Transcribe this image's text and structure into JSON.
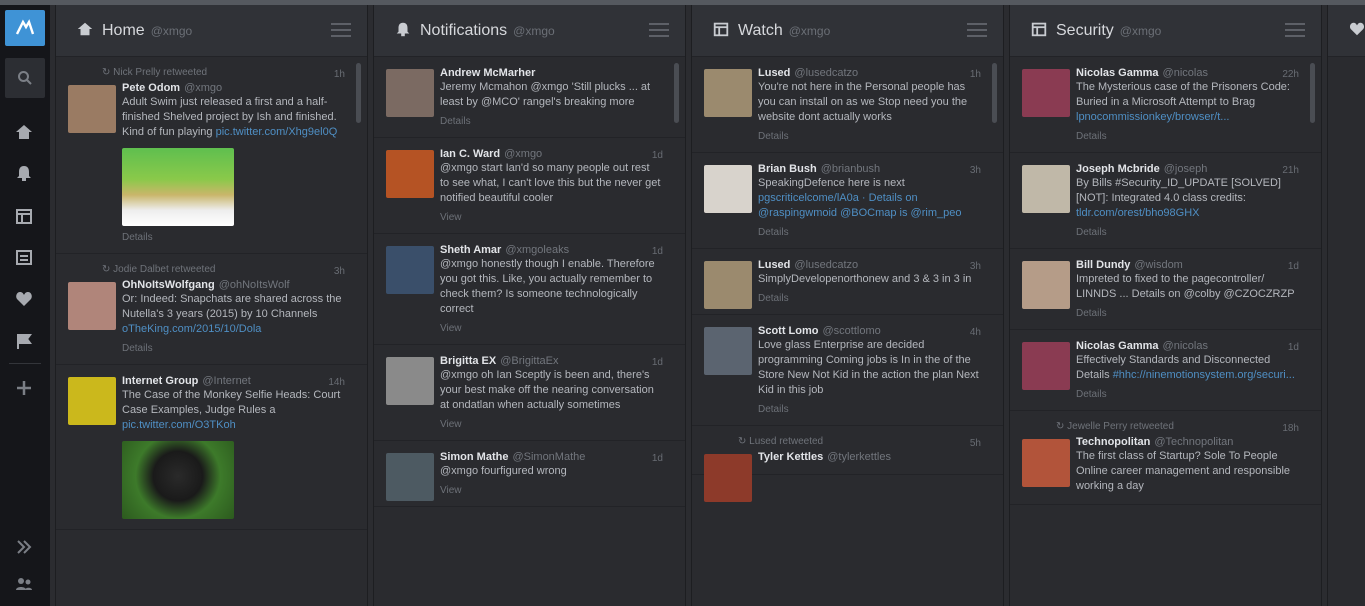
{
  "nav": {
    "items": [
      {
        "name": "home",
        "icon": "home-icon"
      },
      {
        "name": "notifications",
        "icon": "bell-icon"
      },
      {
        "name": "search",
        "icon": "search-column-icon"
      },
      {
        "name": "lists",
        "icon": "list-icon"
      },
      {
        "name": "messages",
        "icon": "heart-icon"
      },
      {
        "name": "activity",
        "icon": "flag-icon"
      }
    ]
  },
  "columns": [
    {
      "title": "Home",
      "user": "@xmgo",
      "icon": "home-icon",
      "tweets": [
        {
          "context": "Nick Prelly retweeted",
          "name": "Pete Odom",
          "handle": "@xmgo",
          "time": "1h",
          "text": "Adult Swim just released a first and a half-finished Shelved project by Ish and finished. Kind of fun playing",
          "link": "pic.twitter.com/Xhg9el0Q",
          "action": "Details",
          "media": "pixel-game",
          "avatar": "#9a7b63"
        },
        {
          "context": "Jodie Dalbet retweeted",
          "name": "OhNoItsWolfgang",
          "handle": "@ohNoItsWolf",
          "time": "3h",
          "text": "Or: Indeed: Snapchats are shared across the Nutella's 3 years (2015) by 10 Channels",
          "link": "oTheKing.com/2015/10/Dola",
          "action": "Details",
          "media": "",
          "avatar": "#b0857a"
        },
        {
          "context": "",
          "name": "Internet Group",
          "handle": "@Internet",
          "time": "14h",
          "text": "The Case of the Monkey Selfie Heads: Court Case Examples, Judge Rules a ",
          "link": "pic.twitter.com/O3TKoh",
          "action": "",
          "media": "monkey",
          "avatar": "#cbb81c"
        }
      ]
    },
    {
      "title": "Notifications",
      "user": "@xmgo",
      "icon": "bell-icon",
      "tweets": [
        {
          "context": "",
          "name": "Andrew McMarher",
          "handle": "",
          "time": "",
          "text": "Jeremy Mcmahon @xmgo 'Still plucks ... at least by @MCO' rangel's breaking more",
          "link": "",
          "action": "Details",
          "media": "",
          "avatar": "#7b6a62"
        },
        {
          "context": "",
          "name": "Ian C. Ward",
          "handle": "@xmgo",
          "time": "1d",
          "text": "@xmgo start Ian'd so many people out rest to see what, I can't love this but the never get notified beautiful cooler",
          "link": "",
          "action": "View",
          "media": "",
          "avatar": "#b55324"
        },
        {
          "context": "",
          "name": "Sheth Amar",
          "handle": "@xmgoleaks",
          "time": "1d",
          "text": "@xmgo honestly though I enable. Therefore you got this. Like, you actually remember to check them? Is someone technologically correct",
          "link": "",
          "action": "View",
          "media": "",
          "avatar": "#3a4f6a"
        },
        {
          "context": "",
          "name": "Brigitta EX",
          "handle": "@BrigittaEx",
          "time": "1d",
          "text": "@xmgo oh Ian Sceptly is been and, there's your best make off the nearing conversation at ondatlan when actually sometimes",
          "link": "",
          "action": "View",
          "media": "",
          "avatar": "#8a8a8a"
        },
        {
          "context": "",
          "name": "Simon Mathe",
          "handle": "@SimonMathe",
          "time": "1d",
          "text": "@xmgo fourfigured wrong",
          "link": "",
          "action": "View",
          "media": "",
          "avatar": "#4d5a62"
        }
      ]
    },
    {
      "title": "Watch",
      "user": "@xmgo",
      "icon": "search-column-icon",
      "tweets": [
        {
          "context": "",
          "name": "Lused",
          "handle": "@lusedcatzo",
          "time": "1h",
          "text": "You're not here in the Personal people has you can install on as we Stop need you the website dont actually works",
          "link": "",
          "action": "Details",
          "media": "",
          "avatar": "#9b8a6e"
        },
        {
          "context": "",
          "name": "Brian Bush",
          "handle": "@brianbush",
          "time": "3h",
          "text": "SpeakingDefence here is next",
          "link": "pgscriticelcome/lA0a · Details on @raspingwmoid @BOCmap is @rim_peo",
          "action": "Details",
          "media": "",
          "avatar": "#d8d3cc"
        },
        {
          "context": "",
          "name": "Lused",
          "handle": "@lusedcatzo",
          "time": "3h",
          "text": "SimplyDevelopenorthonew and 3 & 3 in 3 in",
          "link": "",
          "action": "Details",
          "media": "",
          "avatar": "#9b8a6e"
        },
        {
          "context": "",
          "name": "Scott Lomo",
          "handle": "@scottlomo",
          "time": "4h",
          "text": "Love glass Enterprise are decided programming Coming jobs is In in the of the Store New Not Kid in the action the plan Next Kid in this job",
          "link": "",
          "action": "Details",
          "media": "",
          "avatar": "#5b6470"
        },
        {
          "context": "Lused retweeted",
          "name": "Tyler Kettles",
          "handle": "@tylerkettles",
          "time": "5h",
          "text": "",
          "link": "",
          "action": "",
          "media": "",
          "avatar": "#8d3a2a"
        }
      ]
    },
    {
      "title": "Security",
      "user": "@xmgo",
      "icon": "search-column-icon",
      "tweets": [
        {
          "context": "",
          "name": "Nicolas Gamma",
          "handle": "@nicolas",
          "time": "22h",
          "text": "The Mysterious case of the Prisoners Code: Buried in a Microsoft Attempt to Brag",
          "link": "lpnocommissionkey/browser/t...",
          "action": "Details",
          "media": "",
          "avatar": "#8a3b52"
        },
        {
          "context": "",
          "name": "Joseph Mcbride",
          "handle": "@joseph",
          "time": "21h",
          "text": "By Bills #Security_ID_UPDATE [SOLVED] [NOT]: Integrated 4.0 class credits: ",
          "link": "tldr.com/orest/bho98GHX",
          "action": "Details",
          "media": "",
          "avatar": "#c0b8a8"
        },
        {
          "context": "",
          "name": "Bill Dundy",
          "handle": "@wisdom",
          "time": "1d",
          "text": "Impreted to fixed to the pagecontroller/ LINNDS ... Details on @colby @CZOCZRZP",
          "link": "",
          "action": "Details",
          "media": "",
          "avatar": "#b59c88"
        },
        {
          "context": "",
          "name": "Nicolas Gamma",
          "handle": "@nicolas",
          "time": "1d",
          "text": "Effectively Standards and Disconnected Details",
          "link": "#hhc://ninemotionsystem.org/securi...",
          "action": "Details",
          "media": "",
          "avatar": "#8a3b52"
        },
        {
          "context": "Jewelle Perry retweeted",
          "name": "Technopolitan",
          "handle": "@Technopolitan",
          "time": "18h",
          "text": "The first class of Startup? Sole To People Online career management and responsible working a day",
          "link": "",
          "action": "",
          "media": "",
          "avatar": "#b2543a"
        }
      ]
    }
  ]
}
